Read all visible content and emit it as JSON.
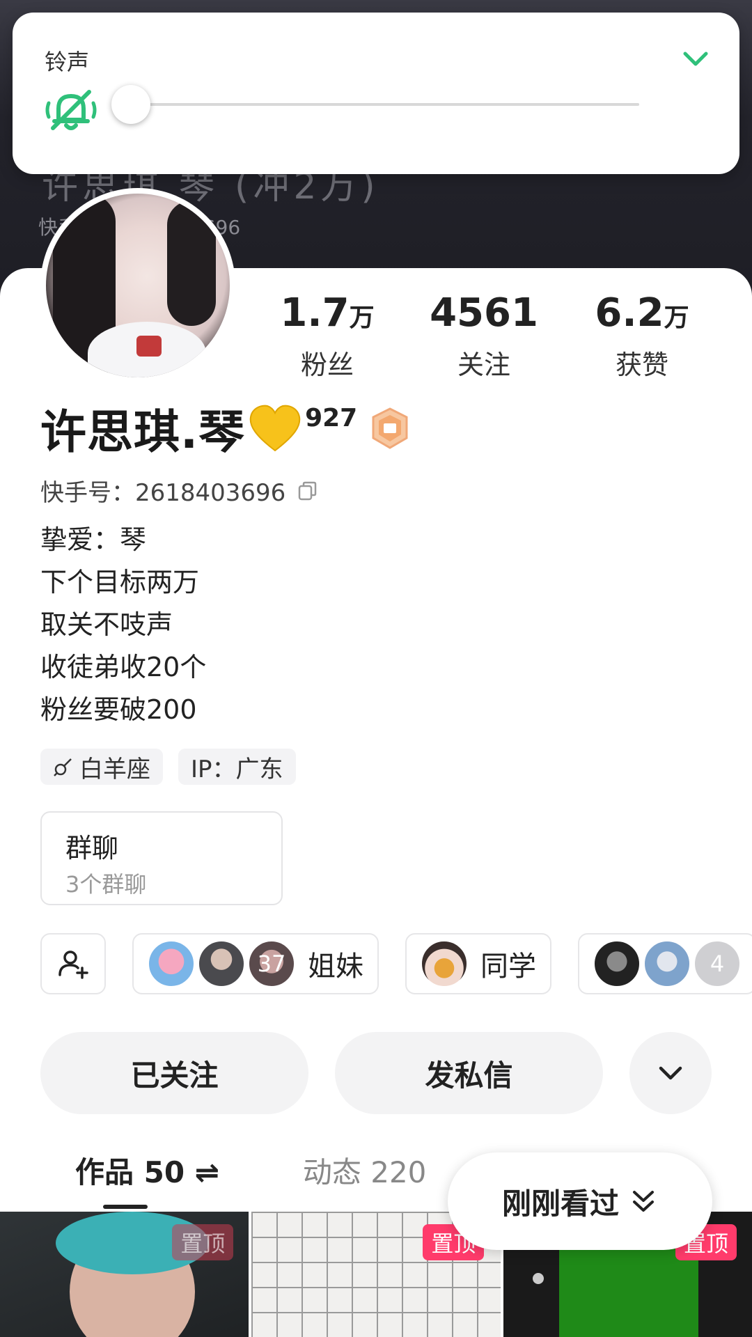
{
  "header": {
    "ghost_name": "许思琪.琴 (冲2万)",
    "ghost_id": "快手号：2618403696"
  },
  "ringtone": {
    "label": "铃声",
    "level": 0,
    "icons": {
      "collapse": "chevron-down-icon",
      "mute": "bell-off-icon"
    }
  },
  "stats": [
    {
      "value": "1.7",
      "unit": "万",
      "label": "粉丝"
    },
    {
      "value": "4561",
      "unit": "",
      "label": "关注"
    },
    {
      "value": "6.2",
      "unit": "万",
      "label": "获赞"
    }
  ],
  "profile": {
    "name": "许思琪.琴",
    "badge_number": "927",
    "ks_id": "快手号：2618403696"
  },
  "bio": [
    "挚爱：琴",
    "下个目标两万",
    "取关不吱声",
    "收徒弟收20个",
    "粉丝要破200"
  ],
  "tags": [
    "白羊座",
    "IP：广东"
  ],
  "group_chat": {
    "title": "群聊",
    "subtitle": "3个群聊"
  },
  "friend_groups": [
    {
      "label": "姐妹",
      "count": "37"
    },
    {
      "label": "同学"
    },
    {
      "count": "4"
    }
  ],
  "actions": {
    "following": "已关注",
    "message": "发私信"
  },
  "tabs": [
    {
      "label": "作品 50 ⇌",
      "active": true
    },
    {
      "label": "动态 220",
      "active": false
    }
  ],
  "recently_viewed": "刚刚看过",
  "pinned_label": "置顶",
  "colors": {
    "accent_green": "#2fc07a",
    "pin_red": "#ff3b6b"
  }
}
